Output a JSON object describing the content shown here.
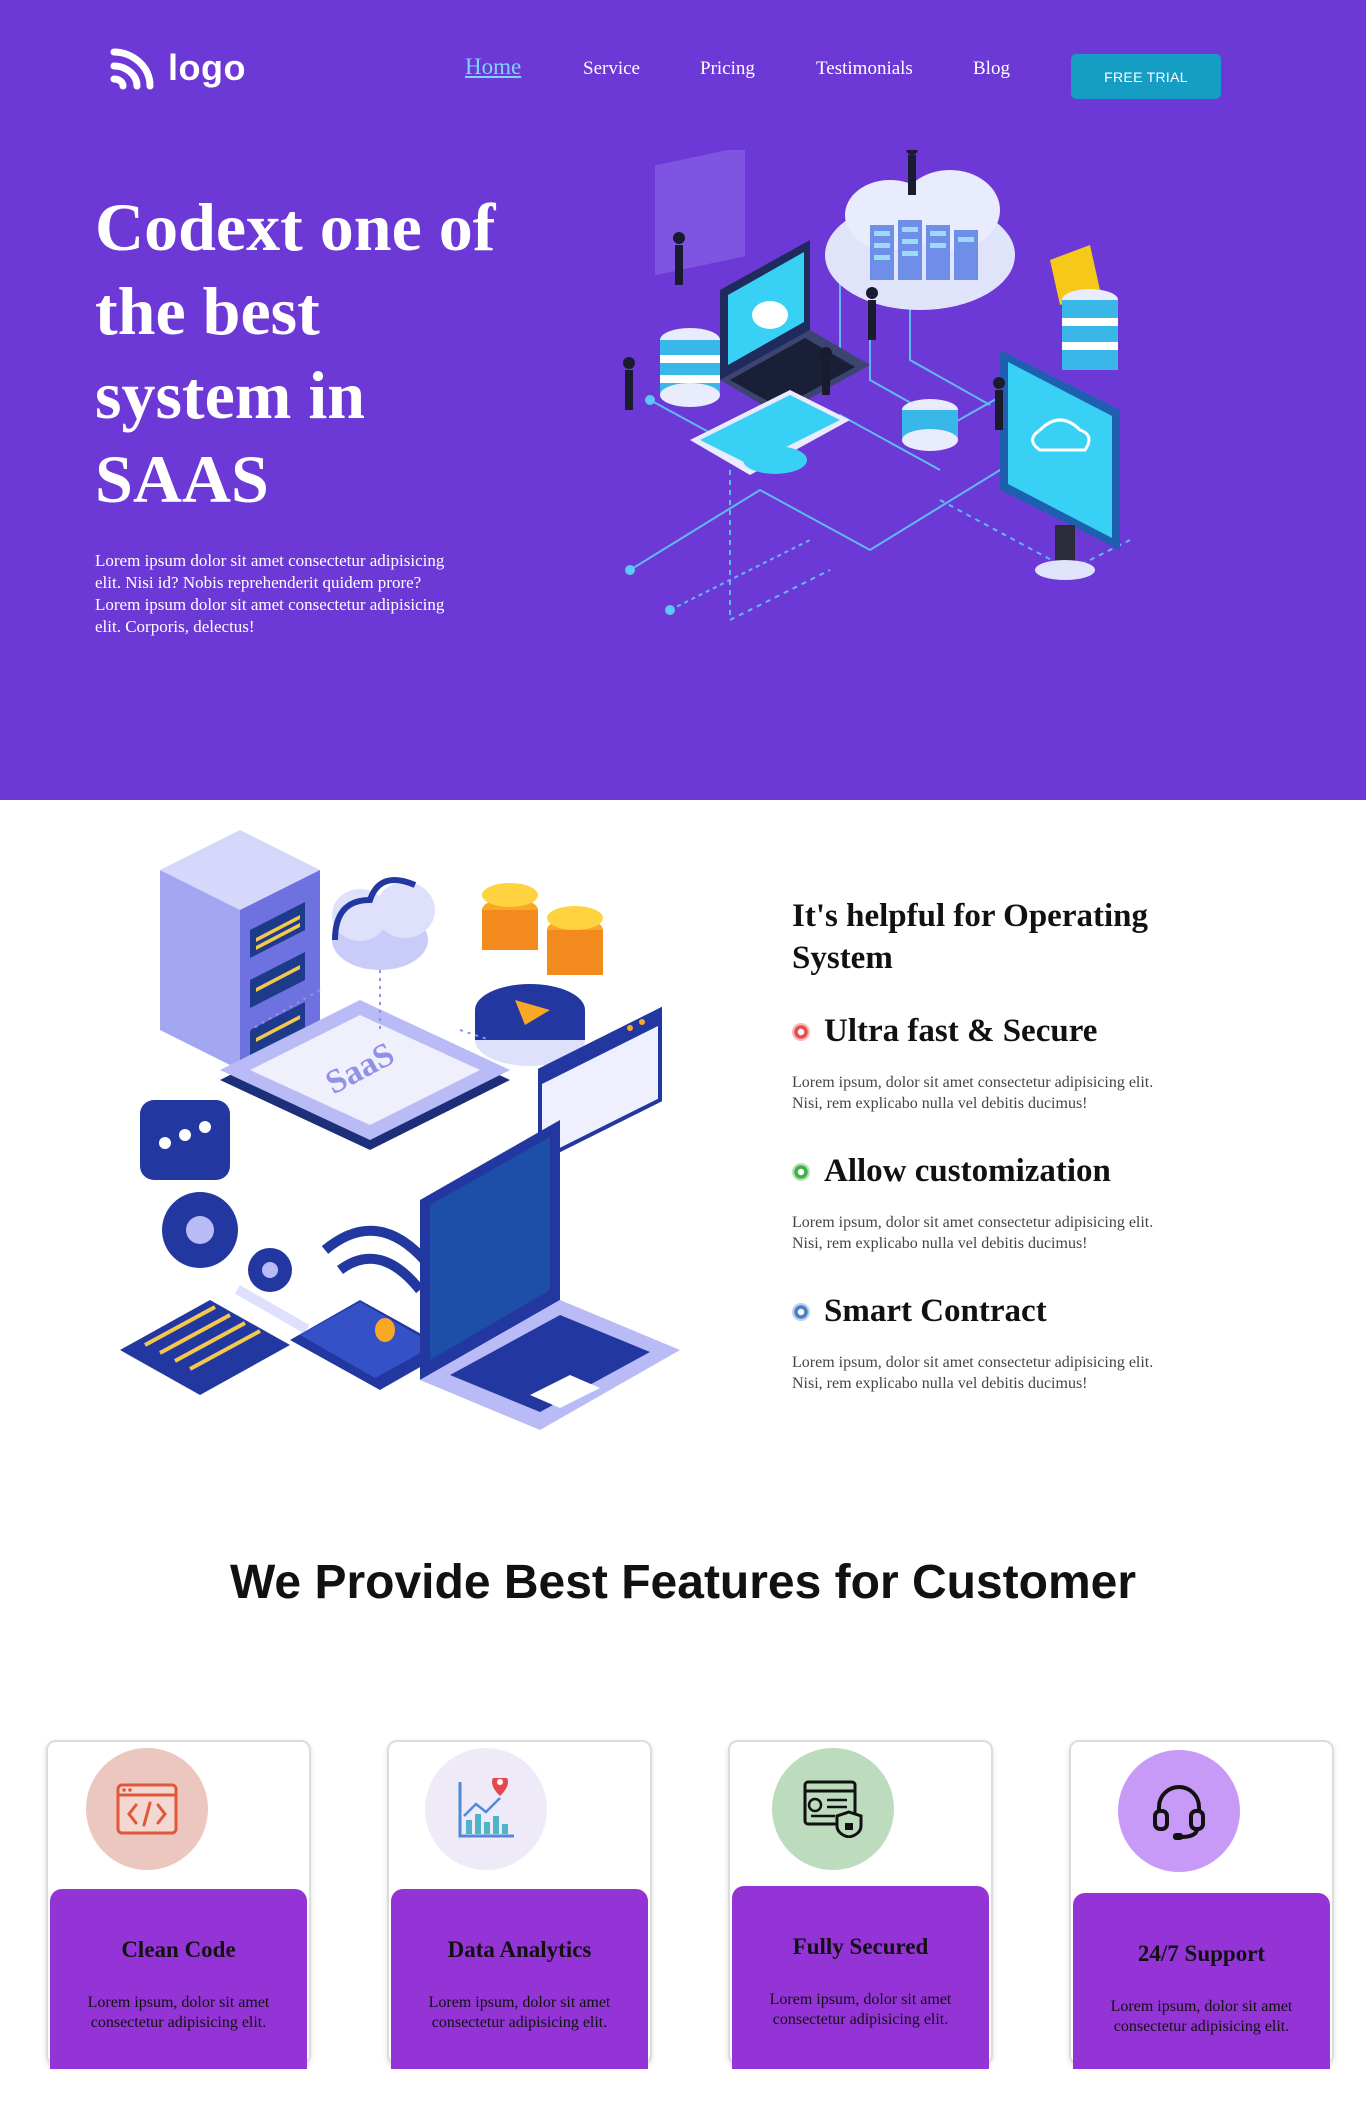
{
  "header": {
    "logo_text": "logo",
    "nav": [
      "Home",
      "Service",
      "Pricing",
      "Testimonials",
      "Blog"
    ],
    "cta": "FREE TRIAL"
  },
  "hero": {
    "title": "Codext one of the best system in SAAS",
    "text": "Lorem ipsum dolor sit amet consectetur adipisicing elit. Nisi id? Nobis reprehenderit quidem prore? Lorem ipsum dolor sit amet consectetur adipisicing elit. Corporis, delectus!"
  },
  "info": {
    "heading": "It's helpful for Operating System",
    "art_label": "SaaS",
    "features": [
      {
        "title": "Ultra fast & Secure",
        "text": "Lorem ipsum, dolor sit amet consectetur adipisicing elit. Nisi, rem explicabo nulla vel debitis ducimus!",
        "color": "#e34f4f"
      },
      {
        "title": "Allow customization",
        "text": "Lorem ipsum, dolor sit amet consectetur adipisicing elit. Nisi, rem explicabo nulla vel debitis ducimus!",
        "color": "#3fb04a"
      },
      {
        "title": "Smart Contract",
        "text": "Lorem ipsum, dolor sit amet consectetur adipisicing elit. Nisi, rem explicabo nulla vel debitis ducimus!",
        "color": "#4a7fc2"
      }
    ]
  },
  "features_section": {
    "title": "We Provide Best Features for Customer",
    "cards": [
      {
        "title": "Clean Code",
        "text": "Lorem ipsum, dolor sit amet consectetur adipisicing elit.",
        "icon": "code-window-icon",
        "circle_color": "#ebc7c0"
      },
      {
        "title": "Data Analytics",
        "text": "Lorem ipsum, dolor sit amet consectetur adipisicing elit.",
        "icon": "analytics-chart-icon",
        "circle_color": "#eeeaf8"
      },
      {
        "title": "Fully Secured",
        "text": "Lorem ipsum, dolor sit amet consectetur adipisicing elit.",
        "icon": "secure-profile-icon",
        "circle_color": "#bcdcbd"
      },
      {
        "title": "24/7 Support",
        "text": "Lorem ipsum, dolor sit amet consectetur adipisicing elit.",
        "icon": "headset-icon",
        "circle_color": "#c69af6"
      }
    ]
  },
  "colors": {
    "hero_bg": "#6c39d6",
    "cta_bg": "#169dc4",
    "card_body": "#9434d6",
    "nav_active": "#7fd3ff"
  }
}
